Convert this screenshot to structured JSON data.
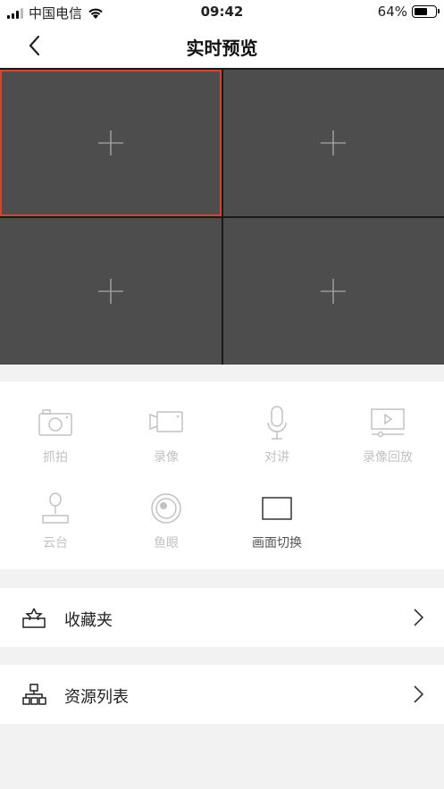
{
  "status_bar": {
    "carrier": "中国电信",
    "time": "09:42",
    "battery": "64%",
    "battery_level": 0.64
  },
  "nav": {
    "title": "实时预览"
  },
  "preview": {
    "cells": [
      "+",
      "+",
      "+",
      "+"
    ],
    "selected_index": 0
  },
  "toolbar": {
    "snapshot": "抓拍",
    "record": "录像",
    "intercom": "对讲",
    "playback": "录像回放",
    "ptz": "云台",
    "fisheye": "鱼眼",
    "switch_layout": "画面切换"
  },
  "menu": {
    "favorites": "收藏夹",
    "resources": "资源列表"
  },
  "colors": {
    "accent": "#d6452a",
    "cell_bg": "#4d4d4d",
    "disabled": "#c2c2c2"
  }
}
